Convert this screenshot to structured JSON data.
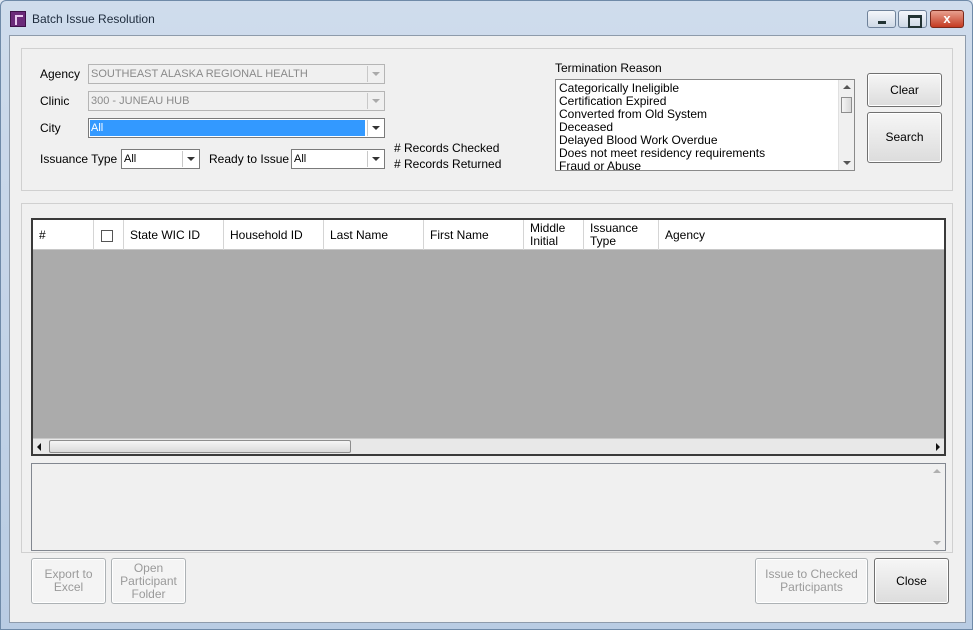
{
  "window": {
    "title": "Batch Issue Resolution",
    "close_glyph": "x"
  },
  "filters": {
    "agency_label": "Agency",
    "agency_value": "SOUTHEAST ALASKA REGIONAL HEALTH",
    "clinic_label": "Clinic",
    "clinic_value": "300 - JUNEAU HUB",
    "city_label": "City",
    "city_value": "All",
    "issuance_type_label": "Issuance Type",
    "issuance_type_value": "All",
    "ready_to_issue_label": "Ready to Issue",
    "ready_to_issue_value": "All",
    "records_checked_label": "# Records Checked",
    "records_returned_label": "# Records Returned"
  },
  "termination": {
    "label": "Termination Reason",
    "items": [
      "Categorically Ineligible",
      "Certification Expired",
      "Converted from Old System",
      "Deceased",
      "Delayed Blood Work Overdue",
      "Does not meet residency requirements",
      "Fraud or Abuse"
    ]
  },
  "actions": {
    "clear_label": "Clear",
    "search_label": "Search"
  },
  "grid": {
    "columns": [
      "#",
      "",
      "State WIC ID",
      "Household ID",
      "Last Name",
      "First Name",
      "Middle Initial",
      "Issuance Type",
      "Agency"
    ]
  },
  "footer": {
    "export_label": "Export to Excel",
    "open_folder_label": "Open Participant Folder",
    "issue_label": "Issue to Checked Participants",
    "close_label": "Close"
  }
}
